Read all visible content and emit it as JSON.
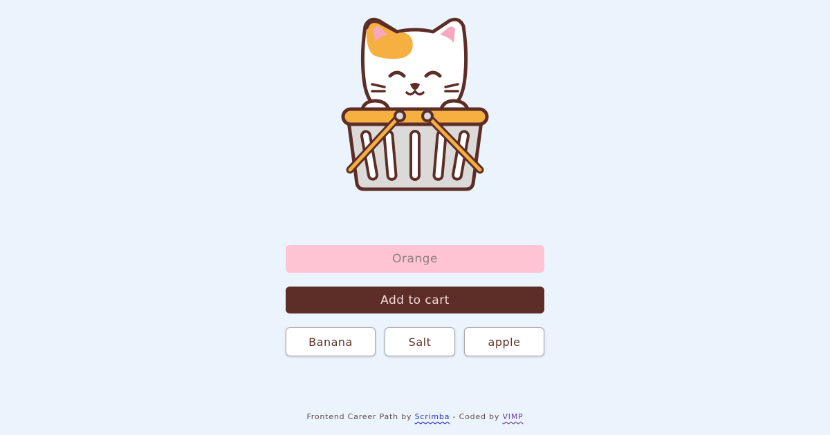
{
  "input": {
    "value": "",
    "placeholder": "Orange"
  },
  "add_button_label": "Add to cart",
  "cart_items": [
    "Banana",
    "Salt",
    "apple"
  ],
  "footer": {
    "text_1": "Frontend Career Path by ",
    "link_1": "Scrimba",
    "text_2": " - Coded by ",
    "link_2": "VIMP"
  },
  "colors": {
    "background": "#ebf4fc",
    "input_bg": "#fec4d4",
    "button_bg": "#5d2e28",
    "button_text": "#f7d9d7",
    "item_text": "#5d2e28",
    "cat_accent": "#f5b041"
  },
  "icons": {
    "mascot": "cat-in-basket-icon"
  }
}
